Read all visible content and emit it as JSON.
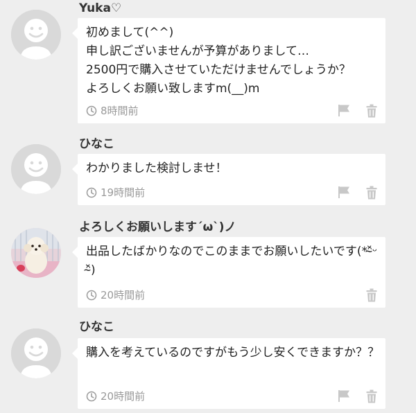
{
  "comments": [
    {
      "user": "Yuka♡",
      "avatar": "default",
      "text": "初めまして(^^)\n申し訳ございませんが予算がありまして…\n2500円で購入させていただけませんでしょうか？\nよろしくお願い致しますm(__)m",
      "time": "8時間前",
      "has_flag": true
    },
    {
      "user": "ひなこ",
      "avatar": "default",
      "text": "わかりました検討しませ！",
      "time": "19時間前",
      "has_flag": true
    },
    {
      "user": "よろしくお願いします´ω`)ノ",
      "avatar": "dog-photo",
      "text": "出品したばかりなのでこのままでお願いしたいです(*ᵔ̴̆ᵕᵔ̴̆)",
      "time": "20時間前",
      "has_flag": false
    },
    {
      "user": "ひなこ",
      "avatar": "default",
      "text": "購入を考えているのですがもう少し安くできますか？？",
      "time": "20時間前",
      "has_flag": true
    }
  ],
  "colors": {
    "background": "#eeeeee",
    "bubble": "#ffffff",
    "muted": "#999999",
    "avatar_placeholder": "#d9d9d9"
  }
}
